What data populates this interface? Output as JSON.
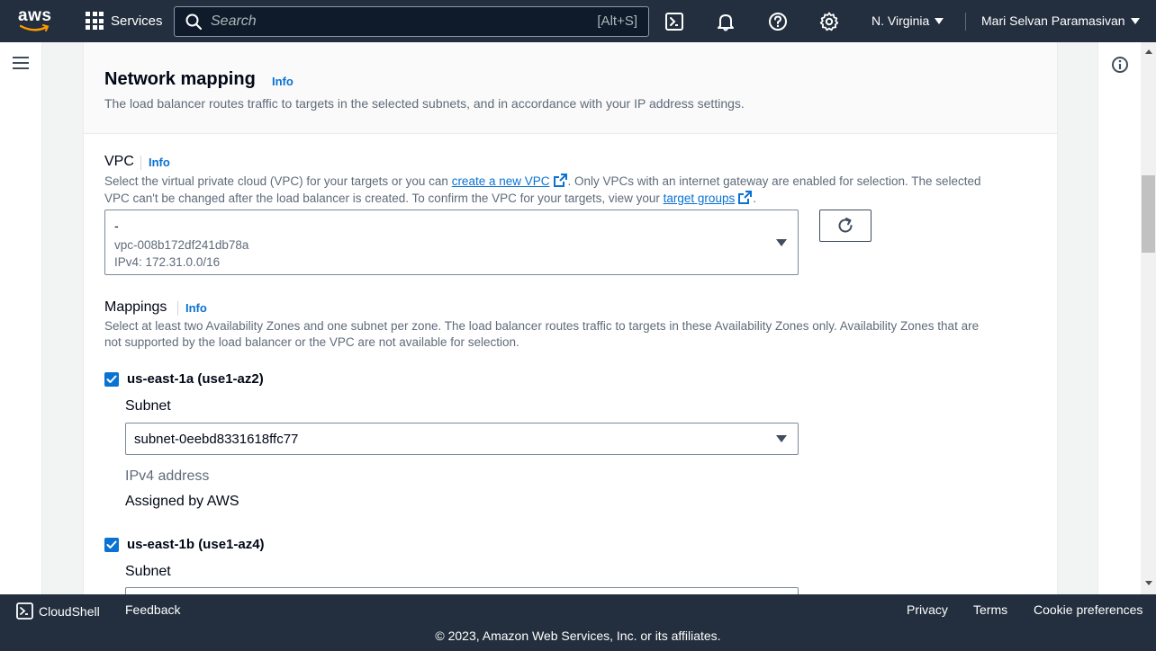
{
  "topnav": {
    "logo_text": "aws",
    "services_label": "Services",
    "search_placeholder": "Search",
    "search_shortcut": "[Alt+S]",
    "region": "N. Virginia",
    "user": "Mari Selvan Paramasivan"
  },
  "section": {
    "title": "Network mapping",
    "info": "Info",
    "description": "The load balancer routes traffic to targets in the selected subnets, and in accordance with your IP address settings."
  },
  "vpc": {
    "label": "VPC",
    "info": "Info",
    "desc_part1": "Select the virtual private cloud (VPC) for your targets or you can ",
    "desc_link1": "create a new VPC",
    "desc_part2": ". Only VPCs with an internet gateway are enabled for selection. The selected",
    "desc_line2_part1": "VPC can't be changed after the load balancer is created. To confirm the VPC for your targets, view your ",
    "desc_link2": "target groups",
    "desc_line2_end": ".",
    "selected_name": "-",
    "selected_id": "vpc-008b172df241db78a",
    "selected_cidr": "IPv4: 172.31.0.0/16"
  },
  "mappings": {
    "label": "Mappings",
    "info": "Info",
    "desc_line1": "Select at least two Availability Zones and one subnet per zone. The load balancer routes traffic to targets in these Availability Zones only. Availability Zones that are",
    "desc_line2": "not supported by the load balancer or the VPC are not available for selection.",
    "zones": [
      {
        "name": "us-east-1a (use1-az2)",
        "subnet_label": "Subnet",
        "subnet_value": "subnet-0eebd8331618ffc77",
        "ipv4_label": "IPv4 address",
        "ipv4_value": "Assigned by AWS"
      },
      {
        "name": "us-east-1b (use1-az4)",
        "subnet_label": "Subnet"
      }
    ]
  },
  "footer": {
    "cloudshell": "CloudShell",
    "feedback": "Feedback",
    "privacy": "Privacy",
    "terms": "Terms",
    "cookie": "Cookie preferences",
    "copyright": "© 2023, Amazon Web Services, Inc. or its affiliates."
  },
  "colors": {
    "nav_bg": "#232f3e",
    "link": "#0972d3",
    "checkbox": "#0972d3",
    "aws_orange": "#ff9900"
  }
}
